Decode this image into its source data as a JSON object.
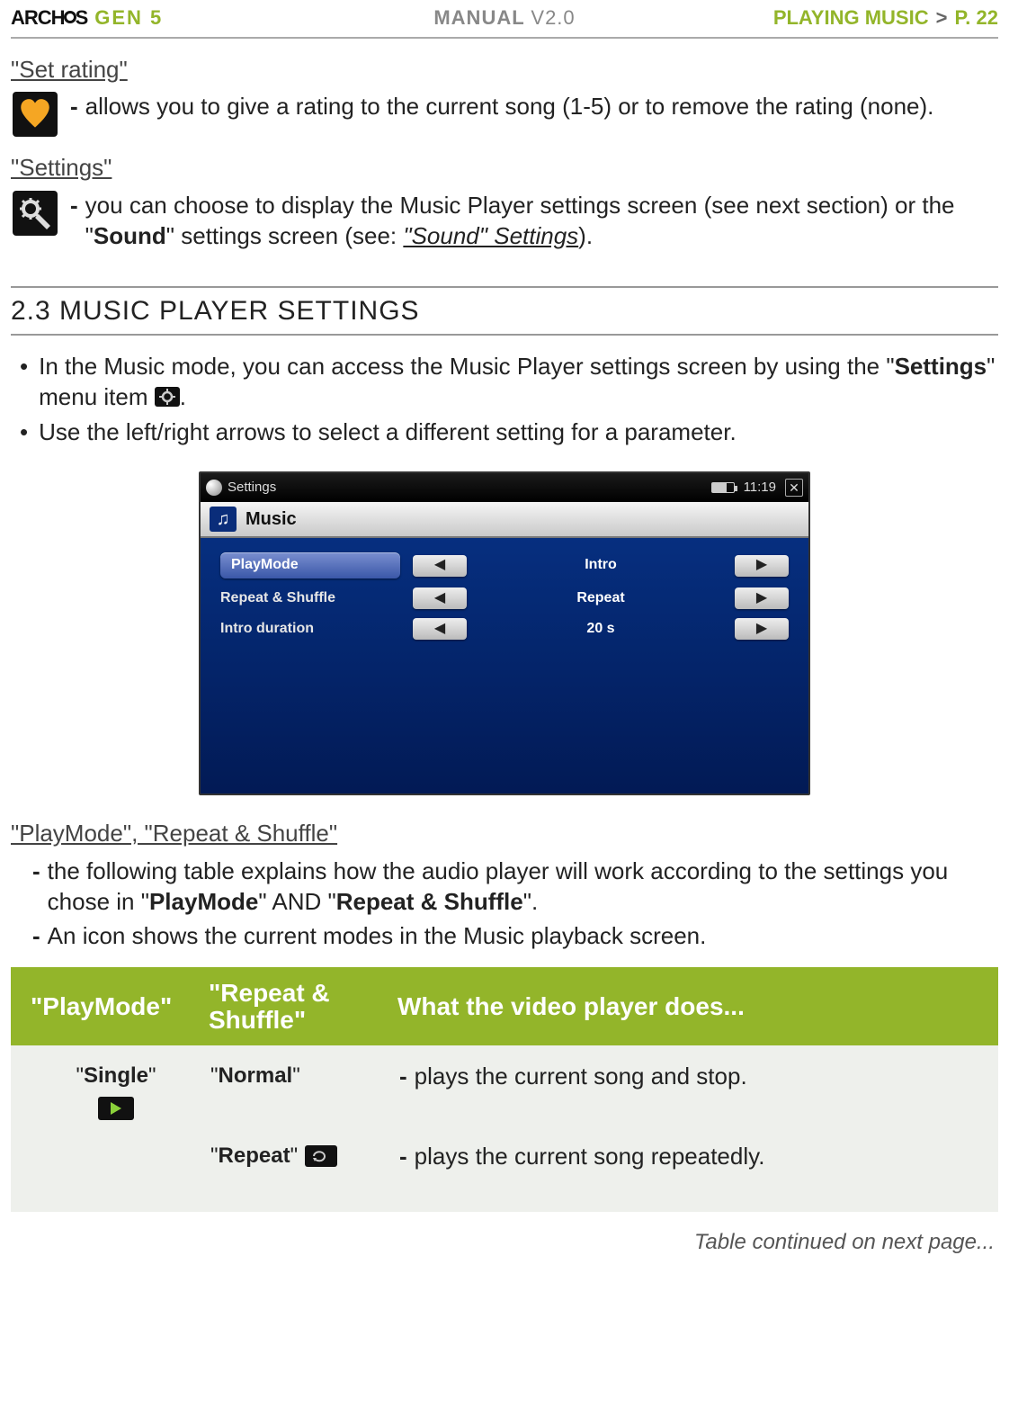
{
  "header": {
    "brand": "ARCHOS",
    "gen": "GEN 5",
    "manual": "MANUAL",
    "version": "V2.0",
    "section": "PLAYING MUSIC",
    "separator": ">",
    "page": "P. 22"
  },
  "set_rating": {
    "heading": "\"Set rating\"",
    "text": "allows you to give a rating to the current song (1-5) or to remove the rating (none)."
  },
  "settings": {
    "heading": "\"Settings\"",
    "text_pre": "you can choose to display the Music Player settings screen (see next section) or the \"",
    "sound_bold": "Sound",
    "text_mid": "\" settings screen (see: ",
    "sound_link": "\"Sound\" Settings",
    "text_post": ")."
  },
  "section23": {
    "title": "2.3 MUSIC PLAYER SETTINGS",
    "bullet1_pre": "In the Music mode, you can access the Music Player settings screen by using the \"",
    "bullet1_bold": "Settings",
    "bullet1_post": "\" menu item ",
    "bullet1_end": ".",
    "bullet2": "Use the left/right arrows to select a different setting for a parameter."
  },
  "screenshot": {
    "topbar_label": "Settings",
    "time": "11:19",
    "panel_title": "Music",
    "rows": [
      {
        "name": "PlayMode",
        "value": "Intro",
        "highlighted": true
      },
      {
        "name": "Repeat & Shuffle",
        "value": "Repeat",
        "highlighted": false
      },
      {
        "name": "Intro duration",
        "value": "20 s",
        "highlighted": false
      }
    ]
  },
  "playmode_section": {
    "heading": "\"PlayMode\", \"Repeat & Shuffle\"",
    "line1_pre": "the following table explains how the audio player will work according to the settings you chose in \"",
    "pm_bold": "PlayMode",
    "line1_mid": "\" AND \"",
    "rs_bold": "Repeat & Shuffle",
    "line1_post": "\".",
    "line2": "An icon shows the current modes in the Music playback screen."
  },
  "table": {
    "head": {
      "c1": "\"PlayMode\"",
      "c2": "\"Repeat & Shuffle\"",
      "c3": "What the video player does..."
    },
    "rows": [
      {
        "playmode": "Single",
        "shuffle": "Normal",
        "desc": "plays the current song and stop.",
        "show_pm_icon": true,
        "show_repeat_icon": false
      },
      {
        "playmode": "",
        "shuffle": "Repeat",
        "desc": "plays the current song repeatedly.",
        "show_pm_icon": false,
        "show_repeat_icon": true
      }
    ]
  },
  "continued": "Table continued on next page..."
}
